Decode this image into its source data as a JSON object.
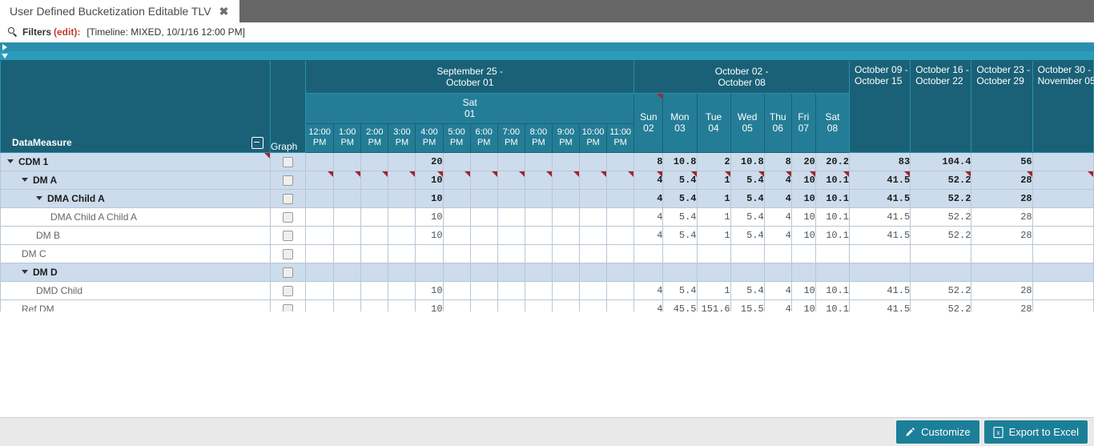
{
  "window": {
    "tab_title": "User Defined Bucketization Editable TLV",
    "close_icon": "close-icon"
  },
  "filters": {
    "search_icon": "search-icon",
    "label": "Filters",
    "edit_link": "(edit):",
    "value": "[Timeline: MIXED, 10/1/16 12:00 PM]"
  },
  "strips": {
    "strip1_icon": "triangle-right-icon",
    "strip2_icon": "triangle-down-icon"
  },
  "grid": {
    "left_header": "DataMeasure",
    "collapse_icon": "minus-box-icon",
    "graph_header": "Graph",
    "week_groups": [
      {
        "label": "September 25 -\nOctober 01",
        "line1": "September 25 -",
        "line2": "October 01"
      },
      {
        "label": "October 02 -\nOctober 08",
        "line1": "October 02 -",
        "line2": "October 08"
      }
    ],
    "week_columns": [
      {
        "line1": "October 09 -",
        "line2": "October 15"
      },
      {
        "line1": "October 16 -",
        "line2": "October 22"
      },
      {
        "line1": "October 23 -",
        "line2": "October 29"
      },
      {
        "line1": "October 30 -",
        "line2": "November 05"
      }
    ],
    "sat_day": {
      "line1": "Sat",
      "line2": "01"
    },
    "hours": [
      "12:00 PM",
      "1:00 PM",
      "2:00 PM",
      "3:00 PM",
      "4:00 PM",
      "5:00 PM",
      "6:00 PM",
      "7:00 PM",
      "8:00 PM",
      "9:00 PM",
      "10:00 PM",
      "11:00 PM"
    ],
    "hours_l1": [
      "12:00",
      "1:00",
      "2:00",
      "3:00",
      "4:00",
      "5:00",
      "6:00",
      "7:00",
      "8:00",
      "9:00",
      "10:00",
      "11:00"
    ],
    "hours_l2": [
      "PM",
      "PM",
      "PM",
      "PM",
      "PM",
      "PM",
      "PM",
      "PM",
      "PM",
      "PM",
      "PM",
      "PM"
    ],
    "days": [
      {
        "line1": "Sun",
        "line2": "02",
        "flag": true
      },
      {
        "line1": "Mon",
        "line2": "03",
        "flag": false
      },
      {
        "line1": "Tue",
        "line2": "04",
        "flag": false
      },
      {
        "line1": "Wed",
        "line2": "05",
        "flag": false
      },
      {
        "line1": "Thu",
        "line2": "06",
        "flag": false
      },
      {
        "line1": "Fri",
        "line2": "07",
        "flag": false
      },
      {
        "line1": "Sat",
        "line2": "08",
        "flag": false
      }
    ],
    "rows": [
      {
        "label": "CDM 1",
        "indent": 0,
        "expandable": true,
        "expanded": true,
        "highlight": true,
        "bold": true,
        "label_flag": true,
        "flags": false,
        "hours": [
          "",
          "",
          "",
          "",
          "20",
          "",
          "",
          "",
          "",
          "",
          "",
          ""
        ],
        "days": [
          "8",
          "10.8",
          "2",
          "10.8",
          "8",
          "20",
          "20.2"
        ],
        "weeks": [
          "83",
          "104.4",
          "56",
          ""
        ]
      },
      {
        "label": "DM A",
        "indent": 1,
        "expandable": true,
        "expanded": true,
        "highlight": true,
        "bold": true,
        "label_flag": false,
        "flags": true,
        "hours": [
          "",
          "",
          "",
          "",
          "10",
          "",
          "",
          "",
          "",
          "",
          "",
          ""
        ],
        "days": [
          "4",
          "5.4",
          "1",
          "5.4",
          "4",
          "10",
          "10.1"
        ],
        "weeks": [
          "41.5",
          "52.2",
          "28",
          ""
        ]
      },
      {
        "label": "DMA Child A",
        "indent": 2,
        "expandable": true,
        "expanded": true,
        "highlight": true,
        "bold": true,
        "label_flag": false,
        "flags": false,
        "hours": [
          "",
          "",
          "",
          "",
          "10",
          "",
          "",
          "",
          "",
          "",
          "",
          ""
        ],
        "days": [
          "4",
          "5.4",
          "1",
          "5.4",
          "4",
          "10",
          "10.1"
        ],
        "weeks": [
          "41.5",
          "52.2",
          "28",
          ""
        ]
      },
      {
        "label": "DMA Child A Child A",
        "indent": 3,
        "expandable": false,
        "expanded": false,
        "highlight": false,
        "bold": false,
        "label_flag": false,
        "flags": false,
        "hours": [
          "",
          "",
          "",
          "",
          "10",
          "",
          "",
          "",
          "",
          "",
          "",
          ""
        ],
        "days": [
          "4",
          "5.4",
          "1",
          "5.4",
          "4",
          "10",
          "10.1"
        ],
        "weeks": [
          "41.5",
          "52.2",
          "28",
          ""
        ]
      },
      {
        "label": "DM B",
        "indent": 2,
        "expandable": false,
        "expanded": false,
        "highlight": false,
        "bold": false,
        "label_flag": false,
        "flags": false,
        "hours": [
          "",
          "",
          "",
          "",
          "10",
          "",
          "",
          "",
          "",
          "",
          "",
          ""
        ],
        "days": [
          "4",
          "5.4",
          "1",
          "5.4",
          "4",
          "10",
          "10.1"
        ],
        "weeks": [
          "41.5",
          "52.2",
          "28",
          ""
        ]
      },
      {
        "label": "DM C",
        "indent": 1,
        "expandable": false,
        "expanded": false,
        "highlight": false,
        "bold": false,
        "label_flag": false,
        "flags": false,
        "hours": [
          "",
          "",
          "",
          "",
          "",
          "",
          "",
          "",
          "",
          "",
          "",
          ""
        ],
        "days": [
          "",
          "",
          "",
          "",
          "",
          "",
          ""
        ],
        "weeks": [
          "",
          "",
          "",
          ""
        ]
      },
      {
        "label": "DM D",
        "indent": 1,
        "expandable": true,
        "expanded": true,
        "highlight": true,
        "bold": true,
        "label_flag": false,
        "flags": false,
        "hours": [
          "",
          "",
          "",
          "",
          "",
          "",
          "",
          "",
          "",
          "",
          "",
          ""
        ],
        "days": [
          "",
          "",
          "",
          "",
          "",
          "",
          ""
        ],
        "weeks": [
          "",
          "",
          "",
          ""
        ]
      },
      {
        "label": "DMD Child",
        "indent": 2,
        "expandable": false,
        "expanded": false,
        "highlight": false,
        "bold": false,
        "label_flag": false,
        "flags": false,
        "hours": [
          "",
          "",
          "",
          "",
          "10",
          "",
          "",
          "",
          "",
          "",
          "",
          ""
        ],
        "days": [
          "4",
          "5.4",
          "1",
          "5.4",
          "4",
          "10",
          "10.1"
        ],
        "weeks": [
          "41.5",
          "52.2",
          "28",
          ""
        ]
      },
      {
        "label": "Ref DM",
        "indent": 1,
        "expandable": false,
        "expanded": false,
        "highlight": false,
        "bold": false,
        "label_flag": false,
        "flags": false,
        "hours": [
          "",
          "",
          "",
          "",
          "10",
          "",
          "",
          "",
          "",
          "",
          "",
          ""
        ],
        "days": [
          "4",
          "45.5",
          "151.6",
          "15.5",
          "4",
          "10",
          "10.1"
        ],
        "weeks": [
          "41.5",
          "52.2",
          "28",
          ""
        ]
      }
    ]
  },
  "footer": {
    "customize_label": "Customize",
    "customize_icon": "pencil-icon",
    "export_label": "Export to Excel",
    "export_icon": "excel-icon"
  },
  "colors": {
    "header_dark": "#1a6177",
    "header_mid": "#247d96",
    "strip": "#2a9cba",
    "row_highlight": "#ccdcec",
    "grid_line": "#b9c6d6",
    "accent_red": "#a3252f",
    "button": "#1b7f99",
    "titlebar": "#666666"
  }
}
